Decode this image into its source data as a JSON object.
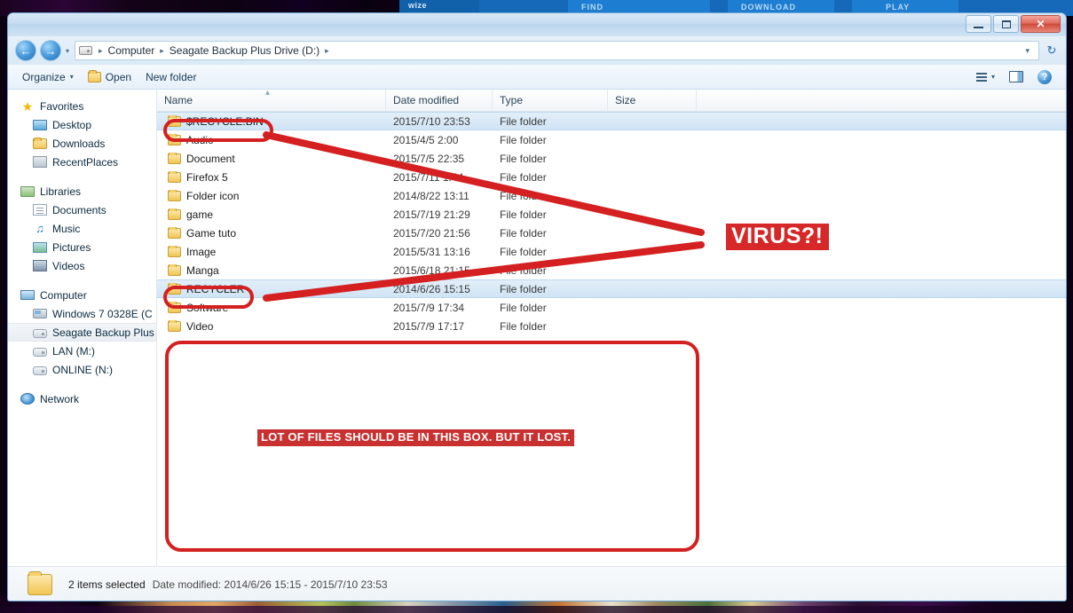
{
  "background": {
    "site_logo": "wize",
    "nav": [
      "FIND",
      "DOWNLOAD",
      "PLAY"
    ]
  },
  "window": {
    "controls": {
      "minimize": "–",
      "maximize": "▭",
      "close": "✕"
    }
  },
  "address_bar": {
    "back_glyph": "←",
    "forward_glyph": "→",
    "history_caret": "▾",
    "breadcrumbs": [
      "Computer",
      "Seagate Backup Plus Drive (D:)"
    ],
    "separator": "▸",
    "dropdown_caret": "▾",
    "refresh_glyph": "↻"
  },
  "toolbar": {
    "organize_label": "Organize",
    "organize_caret": "▾",
    "open_label": "Open",
    "new_folder_label": "New folder",
    "view_caret": "▾",
    "help_glyph": "?"
  },
  "nav_pane": {
    "groups": [
      {
        "header": {
          "label": "Favorites",
          "icon": "star-icon"
        },
        "items": [
          {
            "label": "Desktop",
            "icon": "desktop-icon"
          },
          {
            "label": "Downloads",
            "icon": "folder-icon"
          },
          {
            "label": "RecentPlaces",
            "icon": "recent-places-icon"
          }
        ]
      },
      {
        "header": {
          "label": "Libraries",
          "icon": "libraries-icon"
        },
        "items": [
          {
            "label": "Documents",
            "icon": "document-icon"
          },
          {
            "label": "Music",
            "icon": "music-note-icon"
          },
          {
            "label": "Pictures",
            "icon": "picture-icon"
          },
          {
            "label": "Videos",
            "icon": "video-icon"
          }
        ]
      },
      {
        "header": {
          "label": "Computer",
          "icon": "computer-icon"
        },
        "items": [
          {
            "label": "Windows 7 0328E (C",
            "icon": "hard-disk-icon"
          },
          {
            "label": "Seagate Backup Plus",
            "icon": "drive-icon",
            "selected": true
          },
          {
            "label": "LAN (M:)",
            "icon": "drive-icon"
          },
          {
            "label": "ONLINE (N:)",
            "icon": "drive-icon"
          }
        ]
      },
      {
        "header": {
          "label": "Network",
          "icon": "network-icon"
        },
        "items": []
      }
    ]
  },
  "file_list": {
    "columns": [
      "Name",
      "Date modified",
      "Type",
      "Size"
    ],
    "sort_indicator": "▴",
    "rows": [
      {
        "name": "$RECYCLE.BIN",
        "date": "2015/7/10 23:53",
        "type": "File folder",
        "size": "",
        "selected": true
      },
      {
        "name": "Audio",
        "date": "2015/4/5 2:00",
        "type": "File folder",
        "size": "",
        "selected": false
      },
      {
        "name": "Document",
        "date": "2015/7/5 22:35",
        "type": "File folder",
        "size": "",
        "selected": false
      },
      {
        "name": "Firefox 5",
        "date": "2015/7/11 1:44",
        "type": "File folder",
        "size": "",
        "selected": false
      },
      {
        "name": "Folder icon",
        "date": "2014/8/22 13:11",
        "type": "File folder",
        "size": "",
        "selected": false
      },
      {
        "name": "game",
        "date": "2015/7/19 21:29",
        "type": "File folder",
        "size": "",
        "selected": false
      },
      {
        "name": "Game tuto",
        "date": "2015/7/20 21:56",
        "type": "File folder",
        "size": "",
        "selected": false
      },
      {
        "name": "Image",
        "date": "2015/5/31 13:16",
        "type": "File folder",
        "size": "",
        "selected": false
      },
      {
        "name": "Manga",
        "date": "2015/6/18 21:15",
        "type": "File folder",
        "size": "",
        "selected": false
      },
      {
        "name": "RECYCLER",
        "date": "2014/6/26 15:15",
        "type": "File folder",
        "size": "",
        "selected": true
      },
      {
        "name": "Software",
        "date": "2015/7/9 17:34",
        "type": "File folder",
        "size": "",
        "selected": false
      },
      {
        "name": "Video",
        "date": "2015/7/9 17:17",
        "type": "File folder",
        "size": "",
        "selected": false
      }
    ]
  },
  "status_bar": {
    "selection": "2 items selected",
    "detail": "Date modified: 2014/6/26 15:15 - 2015/7/10 23:53"
  },
  "annotations": {
    "virus_label": "VIRUS?!",
    "box_label": "LOT OF FILES SHOULD BE IN THIS BOX. BUT IT LOST.",
    "accent_red": "#d42020",
    "label_red": "#d62828",
    "box_label_red": "#c93131"
  }
}
